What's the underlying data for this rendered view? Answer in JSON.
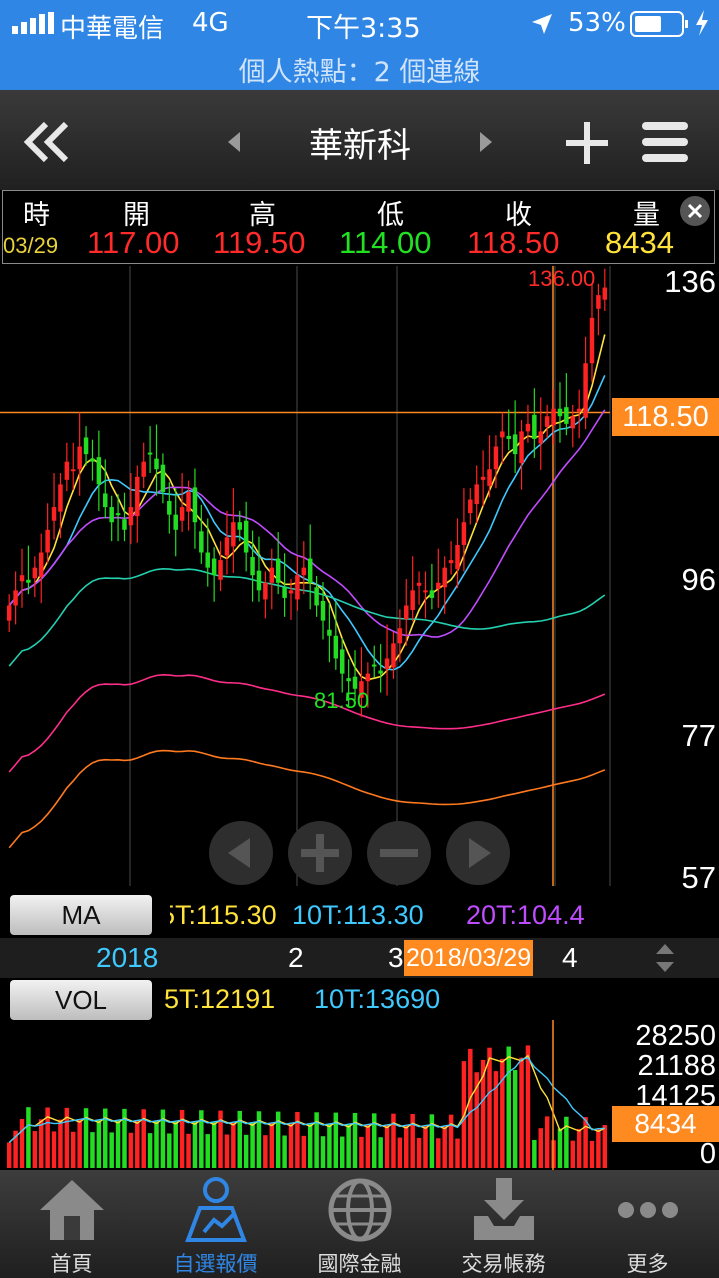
{
  "status_bar": {
    "carrier": "中華電信",
    "network": "4G",
    "time": "下午3:35",
    "battery": "53%",
    "hotspot": "個人熱點：2 個連線"
  },
  "nav": {
    "title": "華新科"
  },
  "ohlc": {
    "headers": [
      "時",
      "開",
      "高",
      "低",
      "收",
      "量"
    ],
    "values": [
      "03/29",
      "117.00",
      "119.50",
      "114.00",
      "118.50",
      "8434"
    ],
    "colors": [
      "#e8d23a",
      "#ff2a2a",
      "#ff2a2a",
      "#22e022",
      "#ff2a2a",
      "#ffe23a"
    ]
  },
  "chart": {
    "high_label": "136.00",
    "low_label": "81.50",
    "y_ticks": [
      "136",
      "96",
      "77",
      "57"
    ],
    "current_price": "118.50",
    "ma_button": "MA",
    "ma_legend": [
      {
        "text": "5T:115.30",
        "color": "#ffe23a"
      },
      {
        "text": "10T:113.30",
        "color": "#3ec9ff"
      },
      {
        "text": "20T:104.4",
        "color": "#c04cff"
      }
    ],
    "dates": [
      "2018",
      "2",
      "3",
      "2018/03/29",
      "4"
    ],
    "vol_button": "VOL",
    "vol_legend": [
      {
        "text": "5T:12191",
        "color": "#ffe23a"
      },
      {
        "text": "10T:13690",
        "color": "#3ec9ff"
      }
    ],
    "vol_ticks": [
      "28250",
      "21188",
      "14125",
      "0"
    ],
    "current_volume": "8434"
  },
  "chart_data": {
    "type": "candlestick",
    "price_range": [
      57,
      136
    ],
    "high": 136.0,
    "low": 81.5,
    "last_close": 118.5,
    "last_open": 117.0,
    "last_high": 119.5,
    "last_low": 114.0,
    "last_volume": 8434,
    "volume_range": [
      0,
      28250
    ],
    "moving_averages": [
      {
        "name": "5T",
        "value": 115.3
      },
      {
        "name": "10T",
        "value": 113.3
      },
      {
        "name": "20T",
        "value": 104.4
      }
    ],
    "volume_averages": [
      {
        "name": "5T",
        "value": 12191
      },
      {
        "name": "10T",
        "value": 13690
      }
    ],
    "closes": [
      93,
      95,
      97,
      96,
      98,
      100,
      103,
      106,
      109,
      112,
      111,
      114,
      113,
      112,
      109,
      106,
      104,
      105,
      103,
      106,
      110,
      112,
      113,
      111,
      108,
      105,
      103,
      106,
      108,
      104,
      100,
      98,
      97,
      99,
      102,
      104,
      103,
      100,
      97,
      95,
      96,
      98,
      96,
      94,
      95,
      97,
      98,
      96,
      93,
      91,
      89,
      86,
      84,
      83,
      82,
      83,
      84,
      85,
      84,
      86,
      88,
      90,
      93,
      95,
      96,
      95,
      94,
      96,
      98,
      99,
      101,
      104,
      107,
      109,
      110,
      111,
      114,
      116,
      115,
      113,
      116,
      117,
      115,
      116,
      118,
      119,
      118,
      117,
      118,
      119,
      125,
      131,
      134,
      135
    ]
  },
  "tabs": [
    {
      "label": "首頁"
    },
    {
      "label": "自選報價"
    },
    {
      "label": "國際金融"
    },
    {
      "label": "交易帳務"
    },
    {
      "label": "更多"
    }
  ]
}
